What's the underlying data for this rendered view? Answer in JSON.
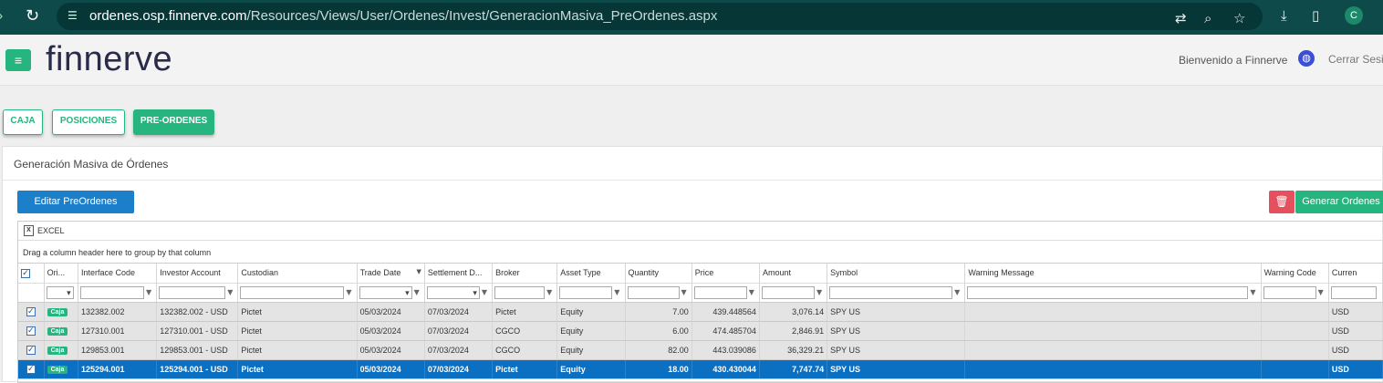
{
  "browser": {
    "url_host": "ordenes.osp.finnerve.com",
    "url_path": "/Resources/Views/User/Ordenes/Invest/GeneracionMasiva_PreOrdenes.aspx",
    "profile_initial": "C"
  },
  "header": {
    "logo": "finnerve",
    "welcome": "Bienvenido a Finnerve",
    "logout": "Cerrar Sesió"
  },
  "tabs": [
    {
      "label": "CAJA",
      "active": false
    },
    {
      "label": "POSICIONES",
      "active": false
    },
    {
      "label": "PRE-ORDENES",
      "active": true
    }
  ],
  "panel": {
    "title": "Generación Masiva de Órdenes",
    "edit_button": "Editar PreOrdenes",
    "generate_button": "Generar Ordenes"
  },
  "grid": {
    "export_label": "EXCEL",
    "group_hint": "Drag a column header here to group by that column",
    "columns": [
      "Ori...",
      "Interface Code",
      "Investor Account",
      "Custodian",
      "Trade Date",
      "Settlement D...",
      "Broker",
      "Asset Type",
      "Quantity",
      "Price",
      "Amount",
      "Symbol",
      "Warning Message",
      "Warning Code",
      "Curren"
    ],
    "rows": [
      {
        "origin": "Caja",
        "interface_code": "132382.002",
        "investor_account": "132382.002 - USD",
        "custodian": "Pictet",
        "trade_date": "05/03/2024",
        "settlement_date": "07/03/2024",
        "broker": "Pictet",
        "asset_type": "Equity",
        "quantity": "7.00",
        "price": "439.448564",
        "amount": "3,076.14",
        "symbol": "SPY US",
        "warning_message": "",
        "warning_code": "",
        "currency": "USD",
        "checked": true,
        "selected": false
      },
      {
        "origin": "Caja",
        "interface_code": "127310.001",
        "investor_account": "127310.001 - USD",
        "custodian": "Pictet",
        "trade_date": "05/03/2024",
        "settlement_date": "07/03/2024",
        "broker": "CGCO",
        "asset_type": "Equity",
        "quantity": "6.00",
        "price": "474.485704",
        "amount": "2,846.91",
        "symbol": "SPY US",
        "warning_message": "",
        "warning_code": "",
        "currency": "USD",
        "checked": true,
        "selected": false
      },
      {
        "origin": "Caja",
        "interface_code": "129853.001",
        "investor_account": "129853.001 - USD",
        "custodian": "Pictet",
        "trade_date": "05/03/2024",
        "settlement_date": "07/03/2024",
        "broker": "CGCO",
        "asset_type": "Equity",
        "quantity": "82.00",
        "price": "443.039086",
        "amount": "36,329.21",
        "symbol": "SPY US",
        "warning_message": "",
        "warning_code": "",
        "currency": "USD",
        "checked": true,
        "selected": false
      },
      {
        "origin": "Caja",
        "interface_code": "125294.001",
        "investor_account": "125294.001 - USD",
        "custodian": "Pictet",
        "trade_date": "05/03/2024",
        "settlement_date": "07/03/2024",
        "broker": "Pictet",
        "asset_type": "Equity",
        "quantity": "18.00",
        "price": "430.430044",
        "amount": "7,747.74",
        "symbol": "SPY US",
        "warning_message": "",
        "warning_code": "",
        "currency": "USD",
        "checked": true,
        "selected": true
      }
    ]
  },
  "colors": {
    "accent": "#26b47f",
    "primary": "#1b7fc9",
    "danger": "#e5505f",
    "selected_row": "#0b6fc2",
    "browser_bar": "#0f4a4a"
  }
}
